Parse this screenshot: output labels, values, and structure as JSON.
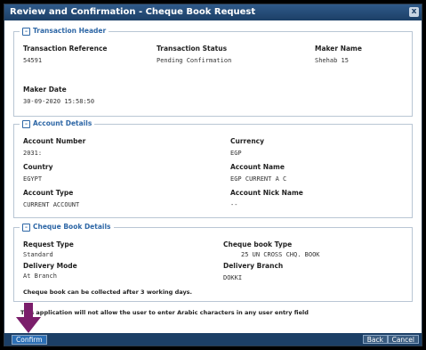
{
  "dialog": {
    "title": "Review and Confirmation - Cheque Book Request",
    "close_glyph": "x"
  },
  "transaction_header": {
    "legend": "Transaction Header",
    "toggle_glyph": "–",
    "transaction_reference_label": "Transaction Reference",
    "transaction_reference_value": "54591",
    "transaction_status_label": "Transaction Status",
    "transaction_status_value": "Pending Confirmation",
    "maker_name_label": "Maker Name",
    "maker_name_value": "Shehab 15",
    "maker_date_label": "Maker Date",
    "maker_date_value": "30-09-2020 15:58:50"
  },
  "account_details": {
    "legend": "Account Details",
    "toggle_glyph": "–",
    "account_number_label": "Account Number",
    "account_number_value": "2031:",
    "currency_label": "Currency",
    "currency_value": "EGP",
    "country_label": "Country",
    "country_value": "EGYPT",
    "account_name_label": "Account Name",
    "account_name_value": "EGP CURRENT A C",
    "account_type_label": "Account Type",
    "account_type_value": "CURRENT ACCOUNT",
    "account_nick_name_label": "Account Nick Name",
    "account_nick_name_value": "--"
  },
  "cheque_book_details": {
    "legend": "Cheque Book Details",
    "toggle_glyph": "–",
    "request_type_label": "Request Type",
    "request_type_value": "Standard",
    "cheque_book_type_label": "Cheque book Type",
    "cheque_book_type_value": "25 UN CROSS CHQ. BOOK",
    "delivery_mode_label": "Delivery Mode",
    "delivery_mode_value": "At Branch",
    "delivery_branch_label": "Delivery Branch",
    "delivery_branch_value": "DOKKI",
    "collection_note": "Cheque book can be collected after 3 working days."
  },
  "notice": {
    "arabic_note": "This application will not allow the user to enter Arabic characters in any user entry field"
  },
  "footer": {
    "confirm_label": "Confirm",
    "back_label": "Back",
    "cancel_label": "Cancel"
  },
  "colors": {
    "title_bar": "#1c3f66",
    "legend_text": "#2e67a6",
    "arrow": "#7b1e6b"
  }
}
